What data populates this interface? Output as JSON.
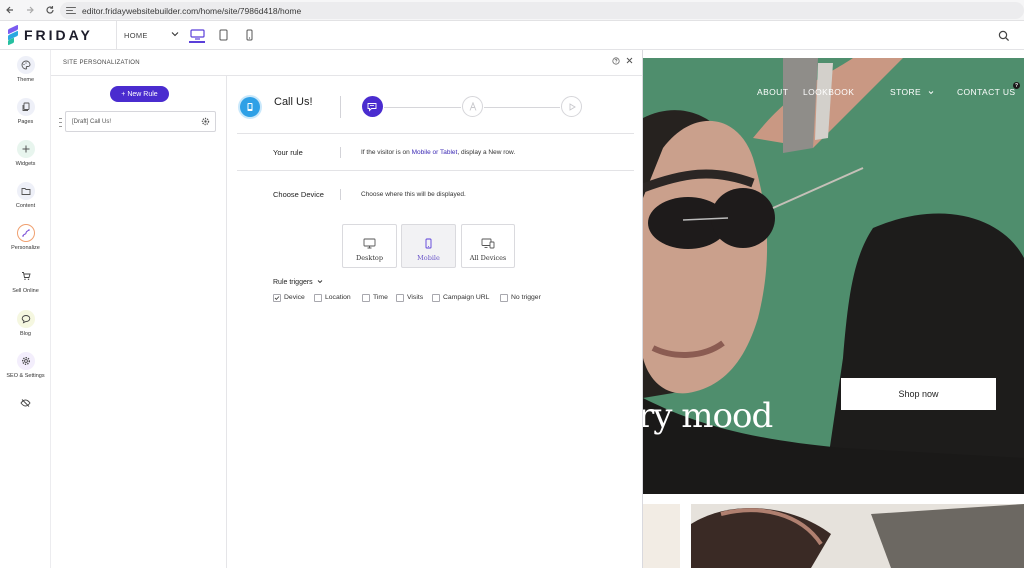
{
  "browser": {
    "url": "editor.fridaywebsitebuilder.com/home/site/7986d418/home"
  },
  "editor": {
    "logo_text": "FRIDAY",
    "page_select": "HOME",
    "accent": "#4a2ccf"
  },
  "sidebar": {
    "items": [
      {
        "label": "Theme",
        "icon": "palette-icon"
      },
      {
        "label": "Pages",
        "icon": "pages-icon"
      },
      {
        "label": "Widgets",
        "icon": "plus-icon"
      },
      {
        "label": "Content",
        "icon": "folder-icon"
      },
      {
        "label": "Personalize",
        "icon": "personalize-icon"
      },
      {
        "label": "Sell Online",
        "icon": "cart-icon"
      },
      {
        "label": "Blog",
        "icon": "chat-icon"
      },
      {
        "label": "SEO & Settings",
        "icon": "gear-icon"
      },
      {
        "label": "",
        "icon": "hide-icon"
      }
    ]
  },
  "panel": {
    "title": "SITE PERSONALIZATION",
    "new_rule": "+ New Rule",
    "rule_card": "[Draft] Call Us!",
    "rule_name": "Call Us!",
    "your_rule_label": "Your rule",
    "your_rule_prefix": "If the visitor is on ",
    "your_rule_devices": "Mobile or Tablet",
    "your_rule_suffix": ", display a New row.",
    "choose_device_label": "Choose  Device",
    "choose_device_text": "Choose where this will be displayed.",
    "devices": {
      "desktop": "Desktop",
      "mobile": "Mobile",
      "all": "All  Devices"
    },
    "rule_triggers": "Rule triggers",
    "triggers": [
      {
        "label": "Device",
        "checked": true
      },
      {
        "label": "Location",
        "checked": false
      },
      {
        "label": "Time",
        "checked": false
      },
      {
        "label": "Visits",
        "checked": false
      },
      {
        "label": "Campaign URL",
        "checked": false
      },
      {
        "label": "No trigger",
        "checked": false
      }
    ]
  },
  "preview": {
    "nav": [
      "ABOUT",
      "LOOKBOOK",
      "STORE",
      "CONTACT US"
    ],
    "shop_now": "Shop now",
    "headline": "ry mood"
  }
}
